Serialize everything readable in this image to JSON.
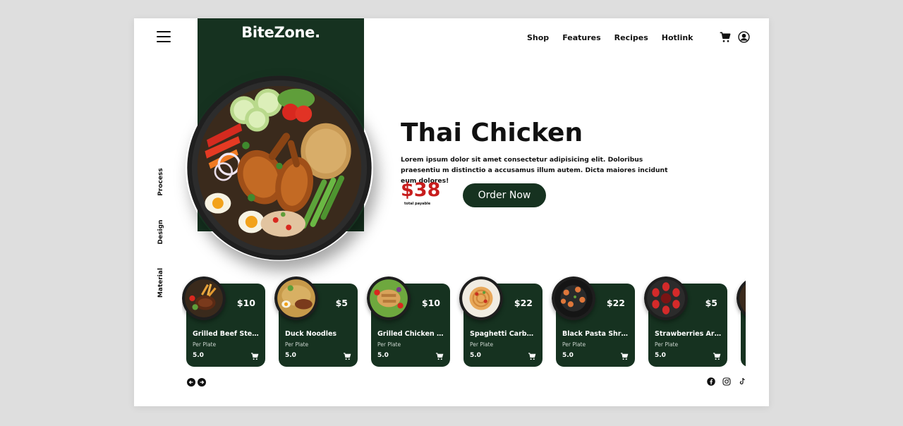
{
  "brand": "BiteZone.",
  "nav": [
    "Shop",
    "Features",
    "Recipes",
    "Hotlink"
  ],
  "side_nav": [
    "Process",
    "Design",
    "Material"
  ],
  "hero": {
    "title": "Thai Chicken",
    "description": "Lorem ipsum dolor sit amet consectetur adipisicing elit. Doloribus praesentiu m distinctio a accusamus illum autem. Dicta maiores incidunt eum dolores!",
    "price": "$38",
    "price_caption": "total payable",
    "order_label": "Order Now"
  },
  "products": [
    {
      "name": "Grilled Beef Steak",
      "price": "$10",
      "unit": "Per Plate",
      "rating": "5.0"
    },
    {
      "name": "Duck Noodles",
      "price": "$5",
      "unit": "Per Plate",
      "rating": "5.0"
    },
    {
      "name": "Grilled Chicken Salad",
      "price": "$10",
      "unit": "Per Plate",
      "rating": "5.0"
    },
    {
      "name": "Spaghetti Carbonara",
      "price": "$22",
      "unit": "Per Plate",
      "rating": "5.0"
    },
    {
      "name": "Black Pasta Shrimp",
      "price": "$22",
      "unit": "Per Plate",
      "rating": "5.0"
    },
    {
      "name": "Strawberries Arnott",
      "price": "$5",
      "unit": "Per Plate",
      "rating": "5.0"
    },
    {
      "name": "",
      "price": "",
      "unit": "",
      "rating": ""
    }
  ],
  "icons": {
    "menu": "hamburger-menu-icon",
    "cart": "cart-icon",
    "user": "user-icon",
    "prev": "arrow-left-icon",
    "next": "arrow-right-icon",
    "socials": [
      "facebook-icon",
      "instagram-icon",
      "tiktok-icon"
    ]
  },
  "colors": {
    "primary": "#163220",
    "price": "#c81d1d",
    "background": "#dedede",
    "card": "#ffffff"
  }
}
